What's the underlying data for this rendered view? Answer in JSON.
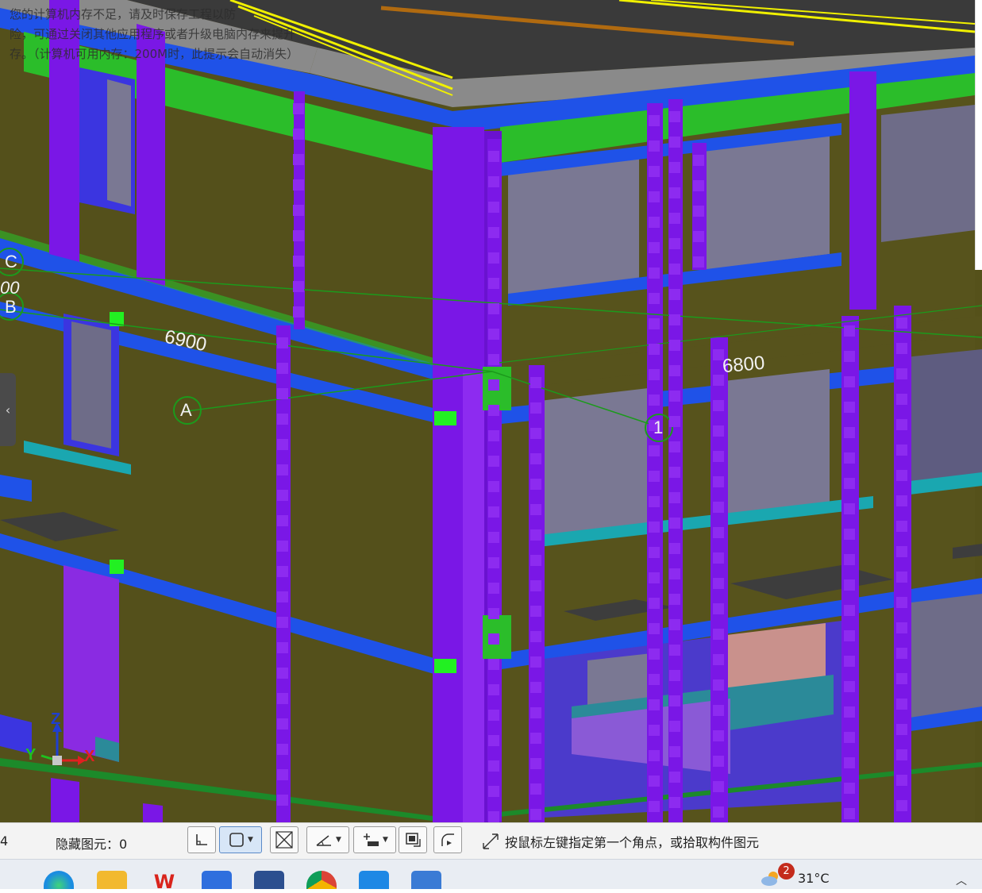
{
  "viewport": {
    "memory_notice": [
      "您的计算机内存不足，请及时保存工程以防",
      "险，可通过关闭其他应用程序或者升级电脑内存来提升",
      "存。（计算机可用内存：200M时，此提示会自动消失）"
    ],
    "dimensions": {
      "left": "6900",
      "right": "6800"
    },
    "axis_labels": {
      "c": "C",
      "b": "B",
      "a": "A",
      "one": "1",
      "partial_dim": "00"
    },
    "triad": {
      "z": "Z",
      "y": "Y",
      "x": "X"
    },
    "side_tab_glyph": "‹"
  },
  "statusbar": {
    "left_number": "4",
    "hidden_elements_label": "隐藏图元：",
    "hidden_elements_value": "0",
    "hint": "按鼠标左键指定第一个角点，或拾取构件图元",
    "tools": [
      {
        "icon": "ortho-icon"
      },
      {
        "icon": "rect-select-icon",
        "dropdown": true,
        "active": true
      },
      {
        "icon": "cross-select-icon"
      },
      {
        "icon": "angle-icon",
        "dropdown": true
      },
      {
        "icon": "offset-icon",
        "dropdown": true
      },
      {
        "icon": "display-icon"
      },
      {
        "icon": "arc-icon"
      }
    ]
  },
  "taskbar": {
    "weather_badge": "2",
    "temperature": "31°C",
    "apps": [
      "edge",
      "explorer",
      "wps",
      "notes",
      "glodon",
      "chrome",
      "study",
      "calculator"
    ]
  },
  "colors": {
    "wall": "#55511a",
    "column": "#7a17e6",
    "beam": "#1f52e8",
    "green_band": "#2bbd2a",
    "slab": "#7a7a7a",
    "window": "#7a7893",
    "cyan": "#1aa7b0"
  }
}
